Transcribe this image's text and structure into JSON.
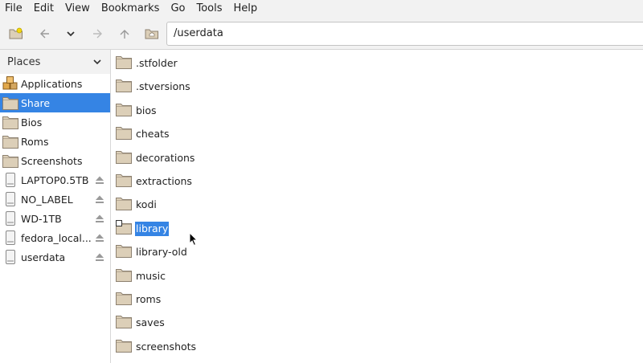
{
  "menu": [
    "File",
    "Edit",
    "View",
    "Bookmarks",
    "Go",
    "Tools",
    "Help"
  ],
  "location_path": "/userdata",
  "sidebar": {
    "header": "Places",
    "items": [
      {
        "label": "Applications",
        "icon": "applications-icon",
        "active": false,
        "eject": false
      },
      {
        "label": "Share",
        "icon": "folder-icon",
        "active": true,
        "eject": false
      },
      {
        "label": "Bios",
        "icon": "folder-icon",
        "active": false,
        "eject": false
      },
      {
        "label": "Roms",
        "icon": "folder-icon",
        "active": false,
        "eject": false
      },
      {
        "label": "Screenshots",
        "icon": "folder-icon",
        "active": false,
        "eject": false
      },
      {
        "label": "LAPTOP0.5TB",
        "icon": "drive-icon",
        "active": false,
        "eject": true
      },
      {
        "label": "NO_LABEL",
        "icon": "drive-icon",
        "active": false,
        "eject": true
      },
      {
        "label": "WD-1TB",
        "icon": "drive-icon",
        "active": false,
        "eject": true
      },
      {
        "label": "fedora_local...",
        "icon": "drive-icon",
        "active": false,
        "eject": true
      },
      {
        "label": "userdata",
        "icon": "drive-icon",
        "active": false,
        "eject": true
      }
    ]
  },
  "files": [
    {
      "name": ".stfolder",
      "selected": false,
      "symlink": false
    },
    {
      "name": ".stversions",
      "selected": false,
      "symlink": false
    },
    {
      "name": "bios",
      "selected": false,
      "symlink": false
    },
    {
      "name": "cheats",
      "selected": false,
      "symlink": false
    },
    {
      "name": "decorations",
      "selected": false,
      "symlink": false
    },
    {
      "name": "extractions",
      "selected": false,
      "symlink": false
    },
    {
      "name": "kodi",
      "selected": false,
      "symlink": false
    },
    {
      "name": "library",
      "selected": true,
      "symlink": true
    },
    {
      "name": "library-old",
      "selected": false,
      "symlink": false
    },
    {
      "name": "music",
      "selected": false,
      "symlink": false
    },
    {
      "name": "roms",
      "selected": false,
      "symlink": false
    },
    {
      "name": "saves",
      "selected": false,
      "symlink": false
    },
    {
      "name": "screenshots",
      "selected": false,
      "symlink": false
    }
  ],
  "colors": {
    "accent": "#3584e4",
    "folder": "#dccfb8",
    "folder_edge": "#8d8170"
  }
}
